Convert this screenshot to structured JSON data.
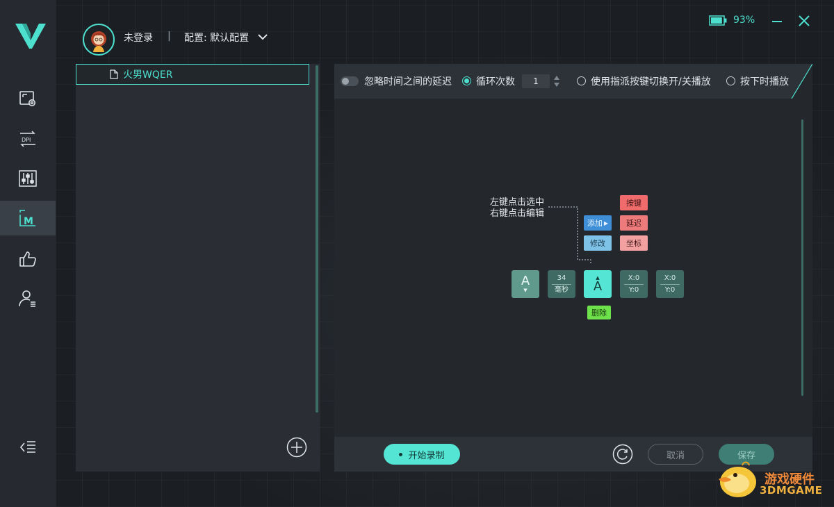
{
  "header": {
    "user_name": "未登录",
    "separator": "|",
    "config_label": "配置: 默认配置",
    "battery_percent": "93%",
    "battery_level": 0.93
  },
  "sidebar": {
    "items": [
      {
        "icon": "monitor-settings-icon"
      },
      {
        "icon": "dpi-icon",
        "label": "DPI"
      },
      {
        "icon": "equalizer-icon"
      },
      {
        "icon": "macro-icon",
        "label": "M",
        "active": true
      },
      {
        "icon": "thumbs-up-icon"
      },
      {
        "icon": "user-profile-icon"
      }
    ],
    "collapse_icon": "collapse-menu-icon"
  },
  "macro_list": {
    "items": [
      {
        "label": "火男WQER",
        "selected": true
      }
    ]
  },
  "toolbar": {
    "ignore_delay_label": "忽略时间之间的延迟",
    "loop_count_label": "循环次数",
    "loop_count_value": "1",
    "toggle_key_label": "使用指派按键切换开/关播放",
    "hold_play_label": "按下时播放"
  },
  "editor": {
    "hint_line1": "左键点击选中",
    "hint_line2": "右键点击编辑",
    "add_label": "添加",
    "edit_label": "修改",
    "key_label": "按键",
    "delay_label": "延迟",
    "coord_label": "坐标",
    "delete_label": "删除",
    "tiles": {
      "key1": "A",
      "delay_value": "34",
      "delay_unit": "毫秒",
      "key2": "A",
      "pos1_x": "X:0",
      "pos1_y": "Y:0",
      "pos2_x": "X:0",
      "pos2_y": "Y:0"
    }
  },
  "footer": {
    "record_label": "开始录制",
    "cancel_label": "取消",
    "save_label": "保存"
  },
  "watermark": {
    "line1": "游戏硬件",
    "line2": "3DMGAME"
  },
  "colors": {
    "accent": "#4de0cf",
    "background": "#1b1e22",
    "sidebar": "#262a30",
    "panel": "#2a2e34"
  }
}
